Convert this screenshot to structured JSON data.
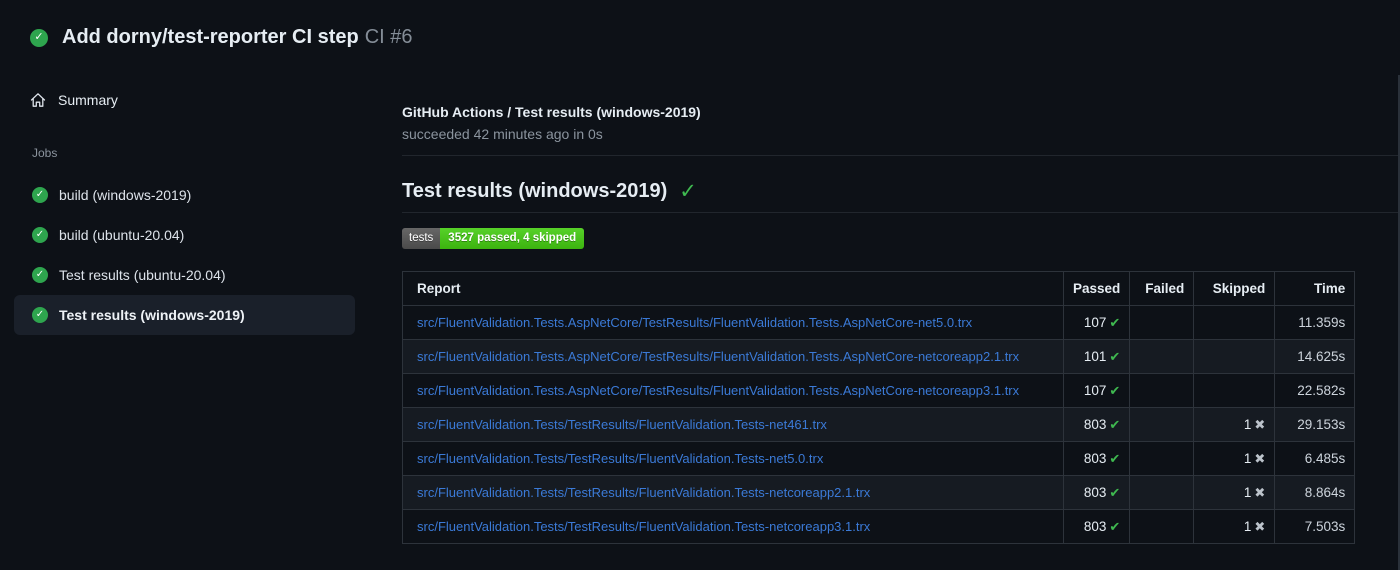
{
  "header": {
    "title": "Add dorny/test-reporter CI step",
    "run_number": "CI #6",
    "status_icon": "check-circle-icon",
    "status_glyph": "✓"
  },
  "sidebar": {
    "summary_label": "Summary",
    "jobs_heading": "Jobs",
    "jobs": [
      {
        "label": "build (windows-2019)",
        "selected": false
      },
      {
        "label": "build (ubuntu-20.04)",
        "selected": false
      },
      {
        "label": "Test results (ubuntu-20.04)",
        "selected": false
      },
      {
        "label": "Test results (windows-2019)",
        "selected": true
      }
    ]
  },
  "main": {
    "check_title": "GitHub Actions / Test results (windows-2019)",
    "check_status": "succeeded 42 minutes ago in 0s",
    "section_heading": "Test results (windows-2019)",
    "heading_check_glyph": "✓",
    "badge": {
      "label": "tests",
      "value": "3527 passed, 4 skipped",
      "label_bg": "#555555",
      "value_bg": "#44cc11"
    },
    "table": {
      "columns": [
        "Report",
        "Passed",
        "Failed",
        "Skipped",
        "Time"
      ],
      "pass_glyph": "✔",
      "skip_glyph": "✖",
      "rows": [
        {
          "report": "src/FluentValidation.Tests.AspNetCore/TestResults/FluentValidation.Tests.AspNetCore-net5.0.trx",
          "passed": "107",
          "failed": "",
          "skipped": "",
          "time": "11.359s"
        },
        {
          "report": "src/FluentValidation.Tests.AspNetCore/TestResults/FluentValidation.Tests.AspNetCore-netcoreapp2.1.trx",
          "passed": "101",
          "failed": "",
          "skipped": "",
          "time": "14.625s"
        },
        {
          "report": "src/FluentValidation.Tests.AspNetCore/TestResults/FluentValidation.Tests.AspNetCore-netcoreapp3.1.trx",
          "passed": "107",
          "failed": "",
          "skipped": "",
          "time": "22.582s"
        },
        {
          "report": "src/FluentValidation.Tests/TestResults/FluentValidation.Tests-net461.trx",
          "passed": "803",
          "failed": "",
          "skipped": "1",
          "time": "29.153s"
        },
        {
          "report": "src/FluentValidation.Tests/TestResults/FluentValidation.Tests-net5.0.trx",
          "passed": "803",
          "failed": "",
          "skipped": "1",
          "time": "6.485s"
        },
        {
          "report": "src/FluentValidation.Tests/TestResults/FluentValidation.Tests-netcoreapp2.1.trx",
          "passed": "803",
          "failed": "",
          "skipped": "1",
          "time": "8.864s"
        },
        {
          "report": "src/FluentValidation.Tests/TestResults/FluentValidation.Tests-netcoreapp3.1.trx",
          "passed": "803",
          "failed": "",
          "skipped": "1",
          "time": "7.503s"
        }
      ]
    }
  },
  "colors": {
    "page_bg": "#0d1117",
    "row_alt_bg": "#161b22",
    "selected_item_bg": "#1a202a",
    "success_green": "#3fb950",
    "circle_green": "#2ea54e",
    "link_blue": "#3b7ad7",
    "muted_text": "#8b949e",
    "border": "#2d333b",
    "cross_gray": "#bcc3cb"
  }
}
